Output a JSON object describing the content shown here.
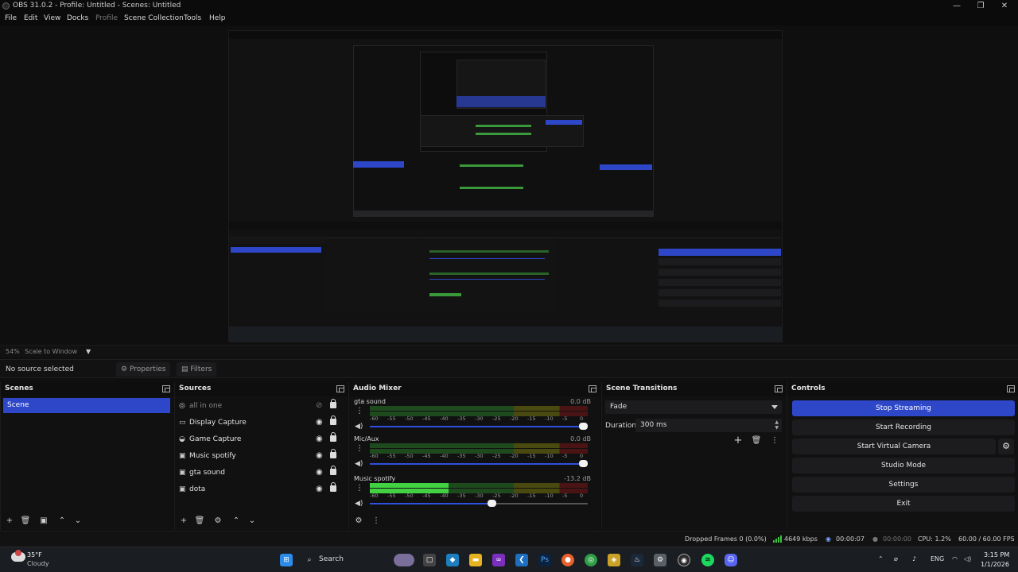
{
  "window": {
    "title": "OBS 31.0.2 - Profile: Untitled - Scenes: Untitled",
    "minimize": "—",
    "maximize": "❐",
    "close": "✕"
  },
  "menu": {
    "file": "File",
    "edit": "Edit",
    "view": "View",
    "docks": "Docks",
    "profile": "Profile",
    "scene_collection": "Scene Collection",
    "tools": "Tools",
    "help": "Help"
  },
  "preview": {
    "zoom": "54%",
    "scale_mode": "Scale to Window"
  },
  "source_toolbar": {
    "no_source": "No source selected",
    "properties": "Properties",
    "filters": "Filters"
  },
  "scenes": {
    "title": "Scenes",
    "items": [
      "Scene"
    ]
  },
  "sources": {
    "title": "Sources",
    "items": [
      {
        "label": "all in one",
        "icon": "group-icon",
        "visible": false
      },
      {
        "label": "Display Capture",
        "icon": "monitor-icon",
        "visible": true
      },
      {
        "label": "Game Capture",
        "icon": "gamepad-icon",
        "visible": true
      },
      {
        "label": "Music spotify",
        "icon": "window-icon",
        "visible": true
      },
      {
        "label": "gta sound",
        "icon": "window-icon",
        "visible": true
      },
      {
        "label": "dota",
        "icon": "window-icon",
        "visible": true
      }
    ]
  },
  "audio_mixer": {
    "title": "Audio Mixer",
    "channels": [
      {
        "name": "gta sound",
        "db": "0.0 dB",
        "level": 0.0,
        "fader": 1.0
      },
      {
        "name": "Mic/Aux",
        "db": "0.0 dB",
        "level": 0.0,
        "fader": 1.0
      },
      {
        "name": "Music spotify",
        "db": "-13.2 dB",
        "level": 0.36,
        "fader": 0.58
      }
    ],
    "ticks": [
      "-60",
      "-55",
      "-50",
      "-45",
      "-40",
      "-35",
      "-30",
      "-25",
      "-20",
      "-15",
      "-10",
      "-5",
      "0"
    ]
  },
  "transitions": {
    "title": "Scene Transitions",
    "selected": "Fade",
    "duration_label": "Duration",
    "duration_value": "300 ms"
  },
  "controls": {
    "title": "Controls",
    "stop_streaming": "Stop Streaming",
    "start_recording": "Start Recording",
    "start_virtual_camera": "Start Virtual Camera",
    "studio_mode": "Studio Mode",
    "settings": "Settings",
    "exit": "Exit"
  },
  "status": {
    "dropped_frames": "Dropped Frames 0 (0.0%)",
    "bitrate": "4649 kbps",
    "stream_time": "00:00:07",
    "record_time": "00:00:00",
    "cpu": "CPU: 1.2%",
    "fps": "60.00 / 60.00 FPS"
  },
  "taskbar": {
    "temp": "35°F",
    "condition": "Cloudy",
    "search": "Search",
    "lang": "ENG",
    "time": "3:15 PM",
    "date": "1/1/2026"
  },
  "colors": {
    "accent": "#2e47c8",
    "meter_green": "#41d141",
    "status_green": "#3fc23f"
  }
}
